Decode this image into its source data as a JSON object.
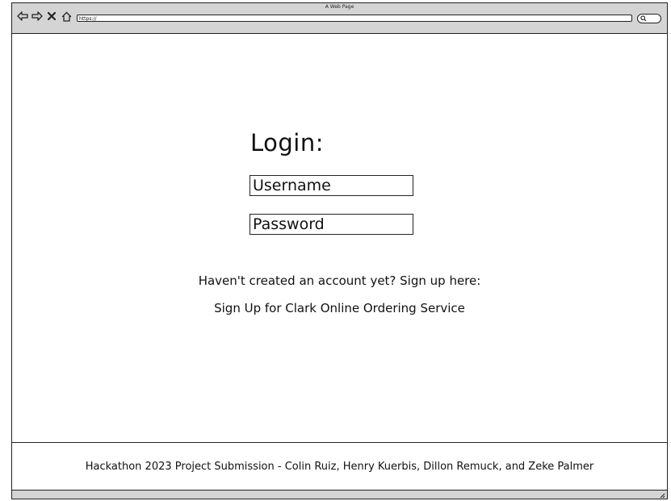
{
  "window": {
    "title": "A Web Page"
  },
  "toolbar": {
    "back_icon": "arrow-left-icon",
    "forward_icon": "arrow-right-icon",
    "close_icon": "x-icon",
    "home_icon": "home-icon",
    "address_value": "https://",
    "search_icon": "search-icon"
  },
  "main": {
    "login_title": "Login:",
    "username_placeholder": "Username",
    "password_placeholder": "Password",
    "signup_prompt": "Haven't created an account yet? Sign up here:",
    "signup_link": "Sign Up for Clark Online Ordering Service"
  },
  "footer": {
    "text": "Hackathon 2023 Project Submission - Colin Ruiz, Henry Kuerbis, Dillon Remuck, and Zeke Palmer"
  },
  "colors": {
    "chrome": "#d4d4d4",
    "border": "#222222",
    "background": "#ffffff"
  }
}
